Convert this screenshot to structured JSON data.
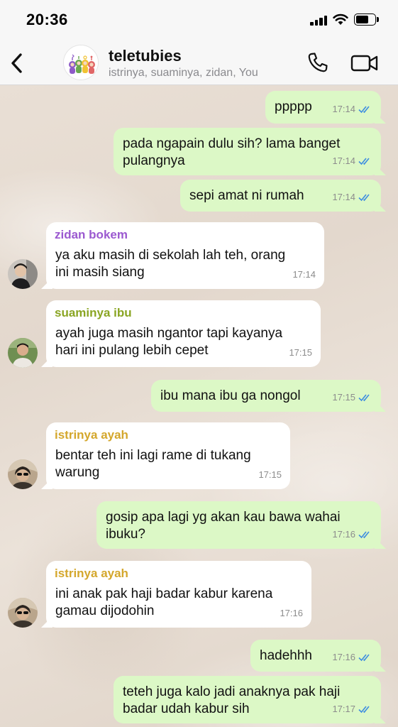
{
  "status": {
    "time": "20:36"
  },
  "header": {
    "title": "teletubies",
    "members": "istrinya, suaminya, zidan, You"
  },
  "colors": {
    "outgoing_bubble": "#dcf8c6",
    "incoming_bubble": "#ffffff",
    "read_tick": "#3d8de0",
    "sender_zidan": "#9b59d0",
    "sender_suaminya": "#8aa523",
    "sender_istrinya": "#d4a72c"
  },
  "messages": [
    {
      "dir": "out",
      "text": "ppppp",
      "time": "17:14"
    },
    {
      "dir": "out",
      "text": "pada ngapain dulu sih? lama banget\npulangnya",
      "time": "17:14"
    },
    {
      "dir": "out",
      "text": "sepi amat ni rumah",
      "time": "17:14"
    },
    {
      "dir": "in",
      "sender": "zidan bokem",
      "text": "ya aku masih di sekolah lah teh, orang\nini masih siang",
      "time": "17:14"
    },
    {
      "dir": "in",
      "sender": "suaminya ibu",
      "text": "ayah juga masih ngantor tapi kayanya\nhari ini pulang lebih cepet",
      "time": "17:15"
    },
    {
      "dir": "out",
      "text": "ibu mana ibu ga nongol",
      "time": "17:15"
    },
    {
      "dir": "in",
      "sender": "istrinya ayah",
      "text": "bentar teh ini lagi rame di tukang\nwarung",
      "time": "17:15"
    },
    {
      "dir": "out",
      "text": "gosip apa lagi yg akan kau bawa wahai\nibuku?",
      "time": "17:16"
    },
    {
      "dir": "in",
      "sender": "istrinya ayah",
      "text": "ini anak pak haji badar kabur karena\ngamau dijodohin",
      "time": "17:16"
    },
    {
      "dir": "out",
      "text": "hadehhh",
      "time": "17:16"
    },
    {
      "dir": "out",
      "text": "teteh juga kalo jadi anaknya pak haji\nbadar udah kabur sih",
      "time": "17:17"
    }
  ]
}
